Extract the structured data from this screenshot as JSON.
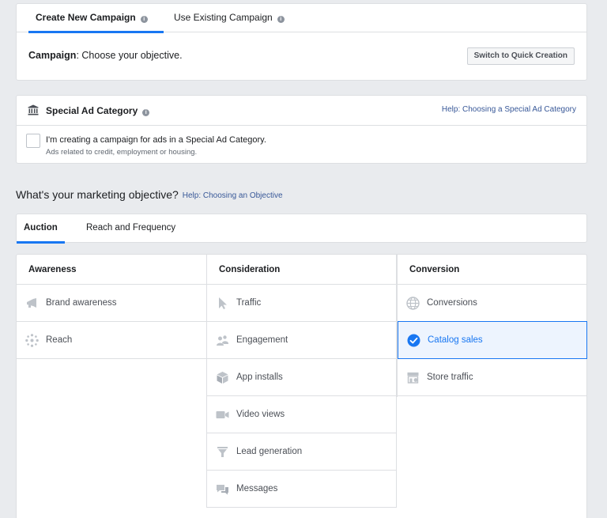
{
  "campaign_tabs": [
    {
      "label": "Create New Campaign",
      "active": true
    },
    {
      "label": "Use Existing Campaign",
      "active": false
    }
  ],
  "campaign": {
    "label": "Campaign",
    "prompt": ": Choose your objective.",
    "quick_button": "Switch to Quick Creation"
  },
  "special_ad": {
    "title": "Special Ad Category",
    "help": "Help: Choosing a Special Ad Category",
    "checkbox_label": "I'm creating a campaign for ads in a Special Ad Category.",
    "checkbox_sub": "Ads related to credit, employment or housing.",
    "checked": false
  },
  "objective": {
    "heading": "What's your marketing objective?",
    "help": "Help: Choosing an Objective"
  },
  "buying_tabs": [
    {
      "label": "Auction",
      "active": true
    },
    {
      "label": "Reach and Frequency",
      "active": false
    }
  ],
  "columns": {
    "awareness": {
      "title": "Awareness",
      "items": [
        {
          "label": "Brand awareness",
          "icon": "megaphone-icon"
        },
        {
          "label": "Reach",
          "icon": "reach-icon"
        }
      ]
    },
    "consideration": {
      "title": "Consideration",
      "items": [
        {
          "label": "Traffic",
          "icon": "cursor-icon"
        },
        {
          "label": "Engagement",
          "icon": "people-icon"
        },
        {
          "label": "App installs",
          "icon": "box-icon"
        },
        {
          "label": "Video views",
          "icon": "video-icon"
        },
        {
          "label": "Lead generation",
          "icon": "funnel-icon"
        },
        {
          "label": "Messages",
          "icon": "chat-icon"
        }
      ]
    },
    "conversion": {
      "title": "Conversion",
      "items": [
        {
          "label": "Conversions",
          "icon": "globe-icon"
        },
        {
          "label": "Catalog sales",
          "icon": "check-circle-icon",
          "selected": true
        },
        {
          "label": "Store traffic",
          "icon": "store-icon"
        }
      ]
    }
  },
  "colors": {
    "accent": "#1877f2",
    "link": "#385898",
    "icon_gray": "#bec3c9"
  }
}
